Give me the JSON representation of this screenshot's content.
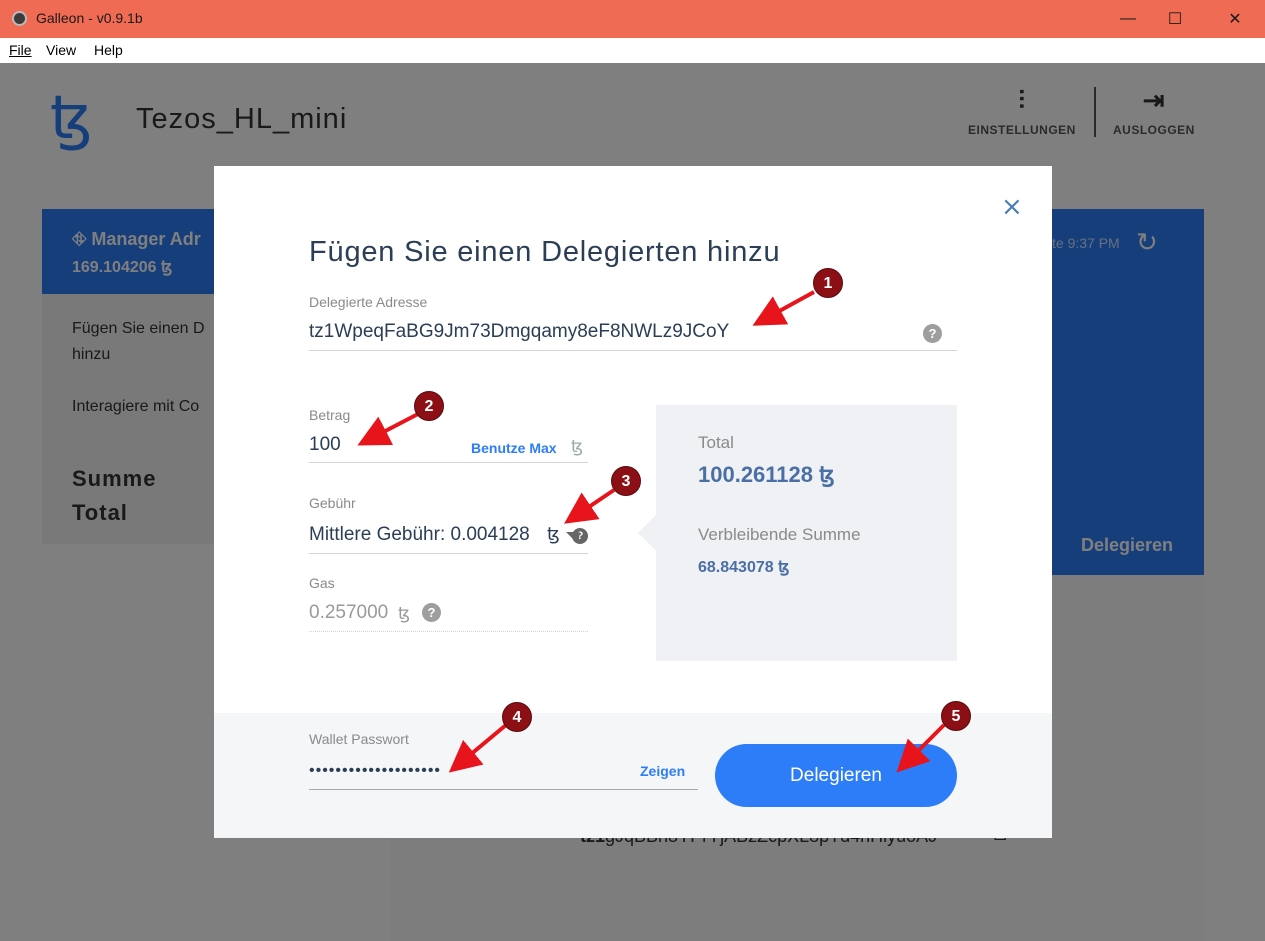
{
  "window": {
    "title": "Galleon - v0.9.1b",
    "minimize": "—",
    "maximize": "☐",
    "close": "✕"
  },
  "menu": {
    "file": "File",
    "view": "View",
    "help": "Help"
  },
  "header": {
    "logo": "ꜩ",
    "wallet_name": "Tezos_HL_mini",
    "settings_label": "EINSTELLUNGEN",
    "settings_icon": "⫶",
    "logout_label": "AUSLOGGEN",
    "logout_icon": "⇥"
  },
  "account": {
    "name": "Manager Adr",
    "balance": "169.104206 ꜩ"
  },
  "sidebar": {
    "add_delegate": "Fügen Sie einen D hinzu",
    "interact": "Interagiere mit Co",
    "sum_label": "Summe",
    "total_label": "Total"
  },
  "main_card": {
    "updated": "te 9:37 PM",
    "refresh_icon": "↻",
    "delegate_label": "Delegieren"
  },
  "address": {
    "prefix": "tz1",
    "rest": "gJqBBh8YPrYjABzZcpXL8pTd4nHiyuoAJ",
    "copy_icon": "⧉",
    "qr_strip": "▀▀ ▄▄▀ ▄▀▄▀ ▀"
  },
  "modal": {
    "close_icon": "×",
    "title": "Fügen Sie einen Delegierten hinzu",
    "delegate_address": {
      "label": "Delegierte Adresse",
      "value": "tz1WpeqFaBG9Jm73Dmgqamy8eF8NWLz9JCoY",
      "help": "?"
    },
    "amount": {
      "label": "Betrag",
      "value": "100",
      "use_max": "Benutze Max",
      "unit": "ꜩ"
    },
    "fee": {
      "label": "Gebühr",
      "value": "Mittlere Gebühr: 0.004128",
      "unit": "ꜩ",
      "help": "?"
    },
    "gas": {
      "label": "Gas",
      "value": "0.257000",
      "unit": "ꜩ",
      "help": "?"
    },
    "summary": {
      "total_label": "Total",
      "total_value": "100.261128 ꜩ",
      "remaining_label": "Verbleibende Summe",
      "remaining_value": "68.843078 ꜩ"
    },
    "password": {
      "label": "Wallet Passwort",
      "value": "••••••••••••••••••••",
      "show": "Zeigen"
    },
    "submit": "Delegieren"
  },
  "markers": [
    "1",
    "2",
    "3",
    "4",
    "5"
  ],
  "colors": {
    "titlebar": "#f06b53",
    "accent": "#2c7df7",
    "marker": "#8b0f14",
    "arrow": "#e8141b"
  }
}
